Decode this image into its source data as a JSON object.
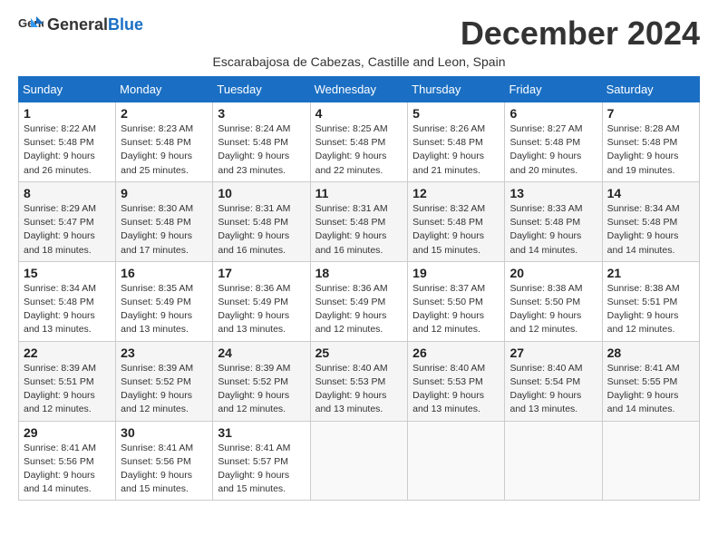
{
  "logo": {
    "general": "General",
    "blue": "Blue"
  },
  "title": "December 2024",
  "subtitle": "Escarabajosa de Cabezas, Castille and Leon, Spain",
  "weekdays": [
    "Sunday",
    "Monday",
    "Tuesday",
    "Wednesday",
    "Thursday",
    "Friday",
    "Saturday"
  ],
  "weeks": [
    [
      {
        "day": "1",
        "sunrise": "8:22 AM",
        "sunset": "5:48 PM",
        "daylight": "9 hours and 26 minutes."
      },
      {
        "day": "2",
        "sunrise": "8:23 AM",
        "sunset": "5:48 PM",
        "daylight": "9 hours and 25 minutes."
      },
      {
        "day": "3",
        "sunrise": "8:24 AM",
        "sunset": "5:48 PM",
        "daylight": "9 hours and 23 minutes."
      },
      {
        "day": "4",
        "sunrise": "8:25 AM",
        "sunset": "5:48 PM",
        "daylight": "9 hours and 22 minutes."
      },
      {
        "day": "5",
        "sunrise": "8:26 AM",
        "sunset": "5:48 PM",
        "daylight": "9 hours and 21 minutes."
      },
      {
        "day": "6",
        "sunrise": "8:27 AM",
        "sunset": "5:48 PM",
        "daylight": "9 hours and 20 minutes."
      },
      {
        "day": "7",
        "sunrise": "8:28 AM",
        "sunset": "5:48 PM",
        "daylight": "9 hours and 19 minutes."
      }
    ],
    [
      {
        "day": "8",
        "sunrise": "8:29 AM",
        "sunset": "5:47 PM",
        "daylight": "9 hours and 18 minutes."
      },
      {
        "day": "9",
        "sunrise": "8:30 AM",
        "sunset": "5:48 PM",
        "daylight": "9 hours and 17 minutes."
      },
      {
        "day": "10",
        "sunrise": "8:31 AM",
        "sunset": "5:48 PM",
        "daylight": "9 hours and 16 minutes."
      },
      {
        "day": "11",
        "sunrise": "8:31 AM",
        "sunset": "5:48 PM",
        "daylight": "9 hours and 16 minutes."
      },
      {
        "day": "12",
        "sunrise": "8:32 AM",
        "sunset": "5:48 PM",
        "daylight": "9 hours and 15 minutes."
      },
      {
        "day": "13",
        "sunrise": "8:33 AM",
        "sunset": "5:48 PM",
        "daylight": "9 hours and 14 minutes."
      },
      {
        "day": "14",
        "sunrise": "8:34 AM",
        "sunset": "5:48 PM",
        "daylight": "9 hours and 14 minutes."
      }
    ],
    [
      {
        "day": "15",
        "sunrise": "8:34 AM",
        "sunset": "5:48 PM",
        "daylight": "9 hours and 13 minutes."
      },
      {
        "day": "16",
        "sunrise": "8:35 AM",
        "sunset": "5:49 PM",
        "daylight": "9 hours and 13 minutes."
      },
      {
        "day": "17",
        "sunrise": "8:36 AM",
        "sunset": "5:49 PM",
        "daylight": "9 hours and 13 minutes."
      },
      {
        "day": "18",
        "sunrise": "8:36 AM",
        "sunset": "5:49 PM",
        "daylight": "9 hours and 12 minutes."
      },
      {
        "day": "19",
        "sunrise": "8:37 AM",
        "sunset": "5:50 PM",
        "daylight": "9 hours and 12 minutes."
      },
      {
        "day": "20",
        "sunrise": "8:38 AM",
        "sunset": "5:50 PM",
        "daylight": "9 hours and 12 minutes."
      },
      {
        "day": "21",
        "sunrise": "8:38 AM",
        "sunset": "5:51 PM",
        "daylight": "9 hours and 12 minutes."
      }
    ],
    [
      {
        "day": "22",
        "sunrise": "8:39 AM",
        "sunset": "5:51 PM",
        "daylight": "9 hours and 12 minutes."
      },
      {
        "day": "23",
        "sunrise": "8:39 AM",
        "sunset": "5:52 PM",
        "daylight": "9 hours and 12 minutes."
      },
      {
        "day": "24",
        "sunrise": "8:39 AM",
        "sunset": "5:52 PM",
        "daylight": "9 hours and 12 minutes."
      },
      {
        "day": "25",
        "sunrise": "8:40 AM",
        "sunset": "5:53 PM",
        "daylight": "9 hours and 13 minutes."
      },
      {
        "day": "26",
        "sunrise": "8:40 AM",
        "sunset": "5:53 PM",
        "daylight": "9 hours and 13 minutes."
      },
      {
        "day": "27",
        "sunrise": "8:40 AM",
        "sunset": "5:54 PM",
        "daylight": "9 hours and 13 minutes."
      },
      {
        "day": "28",
        "sunrise": "8:41 AM",
        "sunset": "5:55 PM",
        "daylight": "9 hours and 14 minutes."
      }
    ],
    [
      {
        "day": "29",
        "sunrise": "8:41 AM",
        "sunset": "5:56 PM",
        "daylight": "9 hours and 14 minutes."
      },
      {
        "day": "30",
        "sunrise": "8:41 AM",
        "sunset": "5:56 PM",
        "daylight": "9 hours and 15 minutes."
      },
      {
        "day": "31",
        "sunrise": "8:41 AM",
        "sunset": "5:57 PM",
        "daylight": "9 hours and 15 minutes."
      },
      null,
      null,
      null,
      null
    ]
  ]
}
